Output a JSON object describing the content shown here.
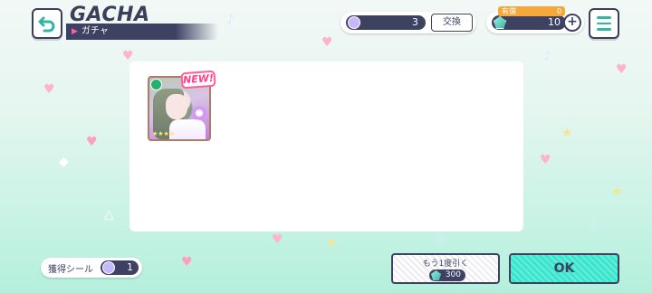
{
  "header": {
    "back_icon": "back-arrow-icon",
    "title": "GACHA",
    "subtitle": "ガチャ",
    "menu_icon": "hamburger-menu-icon"
  },
  "currency": {
    "stone": {
      "icon": "gacha-stone-icon",
      "value": "3",
      "exchange_label": "交換"
    },
    "gems": {
      "icon": "gem-icon",
      "paid_label": "有償",
      "paid_value": "0",
      "value": "10",
      "add_icon": "plus-icon"
    }
  },
  "results": {
    "cards": [
      {
        "badge": "NEW!",
        "attribute_icon": "attribute-pure-icon"
      }
    ]
  },
  "footer": {
    "sticker_label": "獲得シール",
    "sticker_value": "1",
    "draw_again_label": "もう1度引く",
    "draw_again_cost": "300",
    "ok_label": "OK"
  },
  "colors": {
    "navy": "#3d4262",
    "accent_teal": "#37e6cc",
    "new_pink": "#ff3f8a",
    "paid_orange": "#f6a93b"
  }
}
